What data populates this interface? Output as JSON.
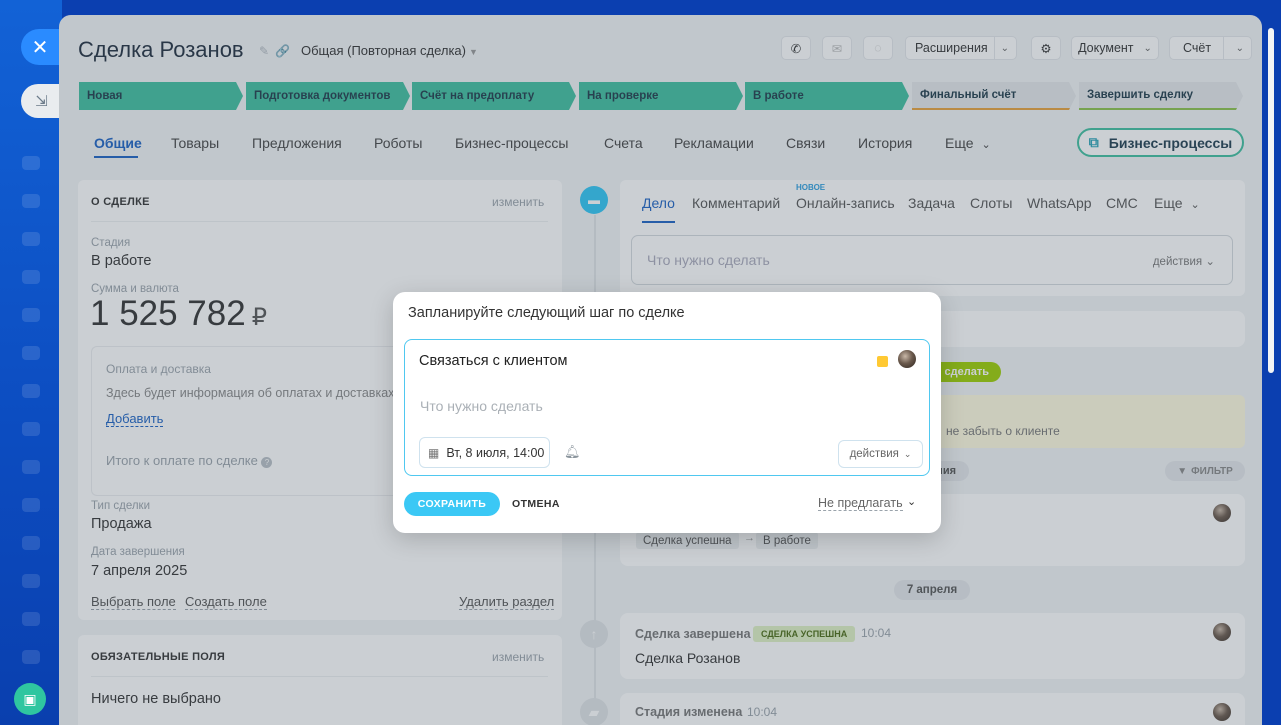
{
  "header": {
    "title": "Сделка Розанов",
    "pipeline": "Общая (Повторная сделка)",
    "extensions_label": "Расширения",
    "document_label": "Документ",
    "invoice_label": "Счёт"
  },
  "stages": [
    {
      "label": "Новая"
    },
    {
      "label": "Подготовка документов"
    },
    {
      "label": "Счёт на предоплату"
    },
    {
      "label": "На проверке"
    },
    {
      "label": "В работе"
    },
    {
      "label": "Финальный счёт"
    },
    {
      "label": "Завершить сделку"
    }
  ],
  "tabs": [
    "Общие",
    "Товары",
    "Предложения",
    "Роботы",
    "Бизнес-процессы",
    "Счета",
    "Рекламации",
    "Связи",
    "История",
    "Еще"
  ],
  "bp_button": "Бизнес-процессы",
  "deal_card": {
    "heading": "О СДЕЛКЕ",
    "edit": "изменить",
    "stage_label": "Стадия",
    "stage_value": "В работе",
    "amount_label": "Сумма и валюта",
    "amount_value": "1 525 782",
    "currency": "₽",
    "payment_title": "Оплата и доставка",
    "payment_text": "Здесь будет информация об оплатах и доставках",
    "add_link": "Добавить",
    "total_label": "Итого к оплате по сделке",
    "type_label": "Тип сделки",
    "type_value": "Продажа",
    "close_date_label": "Дата завершения",
    "close_date_value": "7 апреля 2025",
    "choose_field": "Выбрать поле",
    "create_field": "Создать поле",
    "delete_section": "Удалить раздел"
  },
  "required_card": {
    "heading": "ОБЯЗАТЕЛЬНЫЕ ПОЛЯ",
    "edit": "изменить",
    "empty": "Ничего не выбрано"
  },
  "activity": {
    "tabs": [
      "Дело",
      "Комментарий",
      "Онлайн-запись",
      "Задача",
      "Слоты",
      "WhatsApp",
      "СМС",
      "Еще"
    ],
    "new_badge": "НОВОЕ",
    "input_placeholder": "Что нужно сделать",
    "input_actions": "действия",
    "pill_green": "сделать",
    "reminder_text": "не забыть о клиенте",
    "filter": "ФИЛЬТР",
    "chip_partial": "ния"
  },
  "history": {
    "stage_from": "Сделка успешна",
    "stage_to": "В работе",
    "date_chip": "7 апреля",
    "event1_title": "Сделка завершена",
    "event1_badge": "СДЕЛКА УСПЕШНА",
    "event1_time": "10:04",
    "event1_text": "Сделка Розанов",
    "event2_title": "Стадия изменена",
    "event2_time": "10:04"
  },
  "modal": {
    "title": "Запланируйте следующий шаг по сделке",
    "task": "Связаться с клиентом",
    "placeholder": "Что нужно сделать",
    "date": "Вт, 8 июля, 14:00",
    "actions": "действия",
    "save": "СОХРАНИТЬ",
    "cancel": "ОТМЕНА",
    "suggest": "Не предлагать"
  },
  "colors": {
    "accent": "#3bc8f5",
    "stage_done": "#3fc0a0",
    "brand": "#1b62c4"
  }
}
